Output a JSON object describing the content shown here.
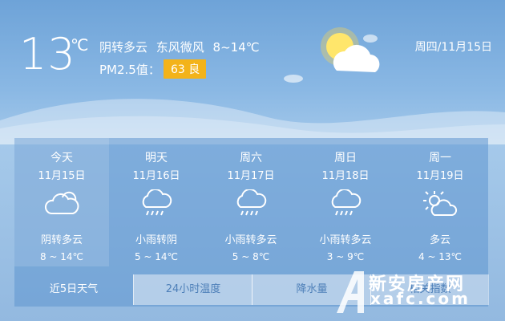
{
  "current": {
    "temp": "13",
    "unit": "℃",
    "description": "阴转多云  东风微风  8~14℃",
    "pm_label": "PM2.5值：",
    "aqi_value": "63 良",
    "date": "周四/11月15日",
    "aqi_color": "#f3b31a"
  },
  "forecast": [
    {
      "name": "今天",
      "date": "11月15日",
      "icon": "cloudy-icon",
      "condition": "阴转多云",
      "range": "8 ~ 14℃"
    },
    {
      "name": "明天",
      "date": "11月16日",
      "icon": "light-rain-icon",
      "condition": "小雨转阴",
      "range": "5 ~ 14℃"
    },
    {
      "name": "周六",
      "date": "11月17日",
      "icon": "light-rain-icon",
      "condition": "小雨转多云",
      "range": "5 ~ 8℃"
    },
    {
      "name": "周日",
      "date": "11月18日",
      "icon": "light-rain-icon",
      "condition": "小雨转多云",
      "range": "3 ~ 9℃"
    },
    {
      "name": "周一",
      "date": "11月19日",
      "icon": "partly-cloudy-icon",
      "condition": "多云",
      "range": "4 ~ 13℃"
    }
  ],
  "tabs": [
    "近5日天气",
    "24小时温度",
    "降水量",
    "相关指数"
  ],
  "watermark": {
    "top": "新安房产网",
    "bottom": "xafc.com"
  }
}
